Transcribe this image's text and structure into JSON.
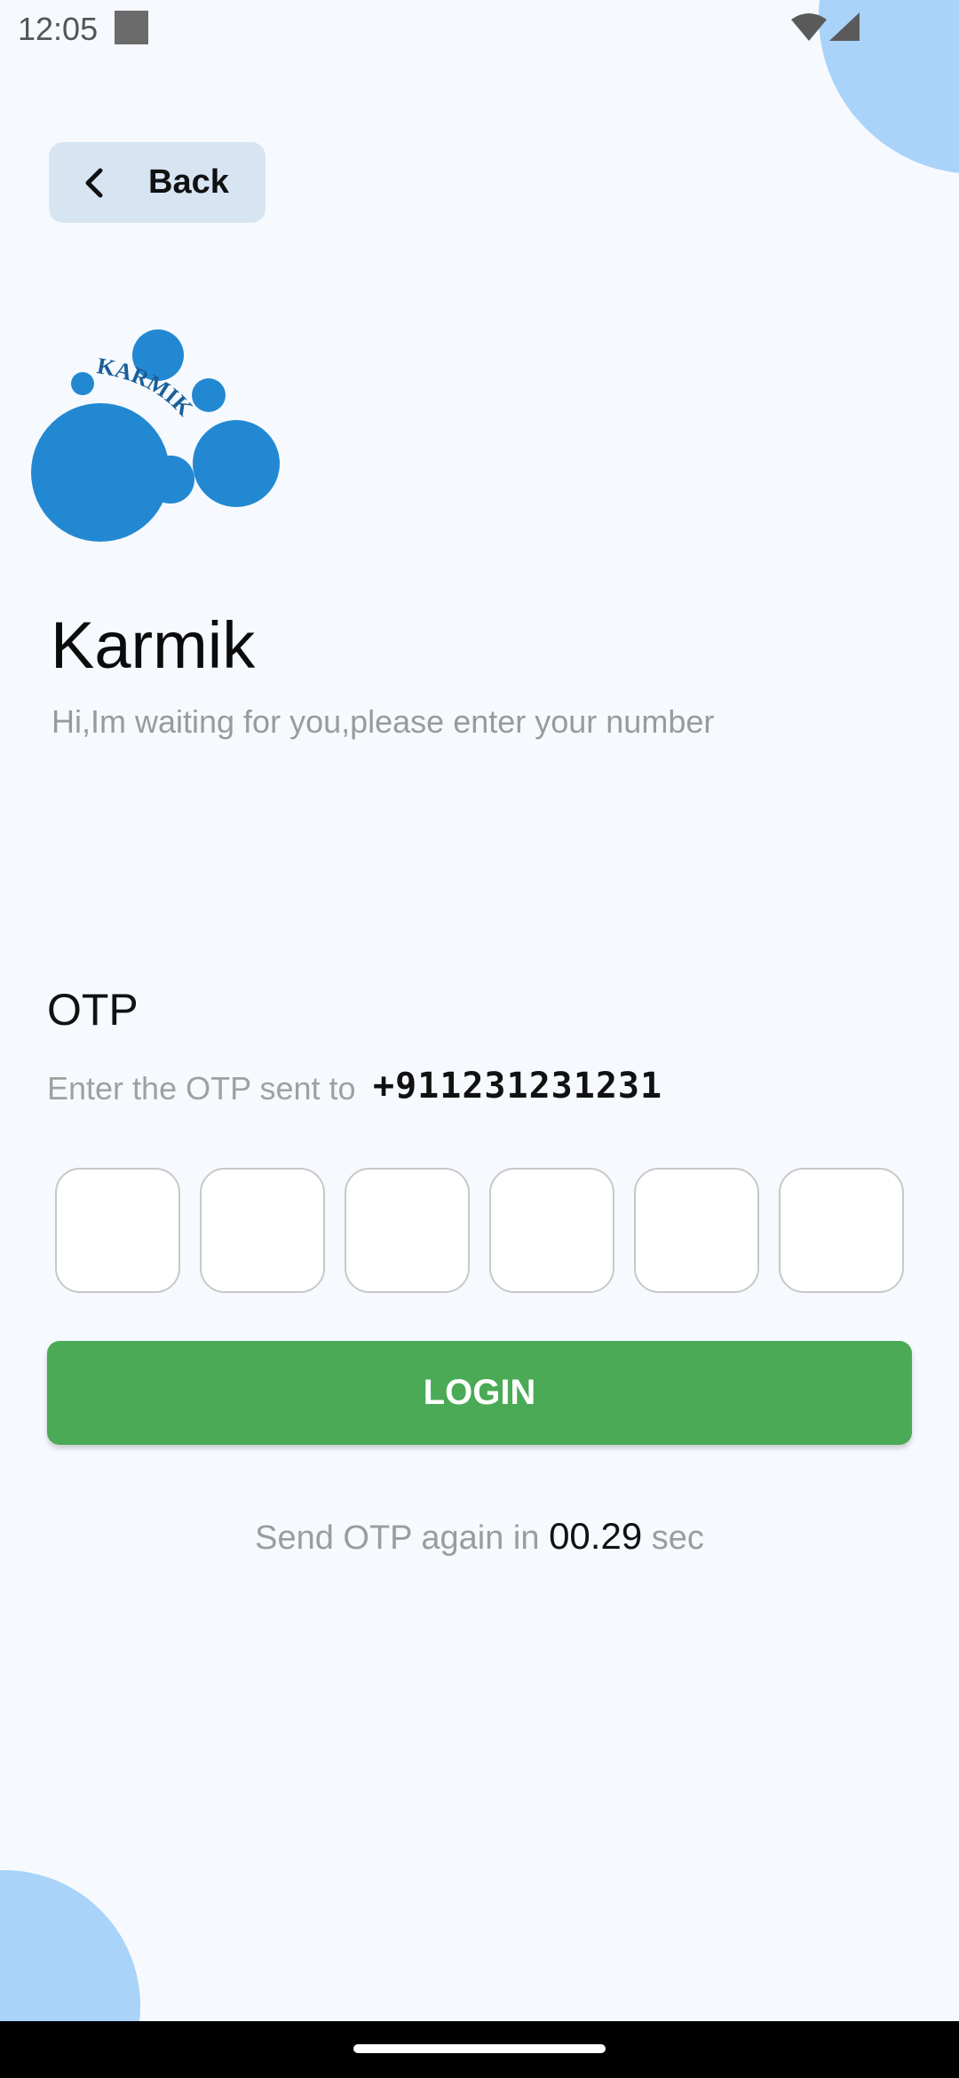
{
  "status_bar": {
    "time": "12:05"
  },
  "header": {
    "back_label": "Back"
  },
  "logo": {
    "text": "KARMIK"
  },
  "brand": {
    "title": "Karmik",
    "subtitle": "Hi,Im waiting for you,please enter your number"
  },
  "otp": {
    "heading": "OTP",
    "instruction": "Enter the OTP sent to",
    "phone": "+911231231231",
    "digits": [
      "",
      "",
      "",
      "",
      "",
      ""
    ]
  },
  "login": {
    "label": "LOGIN"
  },
  "resend": {
    "prefix": "Send OTP again in",
    "timer": "00.29",
    "suffix": "sec"
  },
  "colors": {
    "accent": "#4aaa55",
    "logo_blue": "#2388d2",
    "decor_blue": "#a9d3f9",
    "back_bg": "#d7e5f3"
  }
}
